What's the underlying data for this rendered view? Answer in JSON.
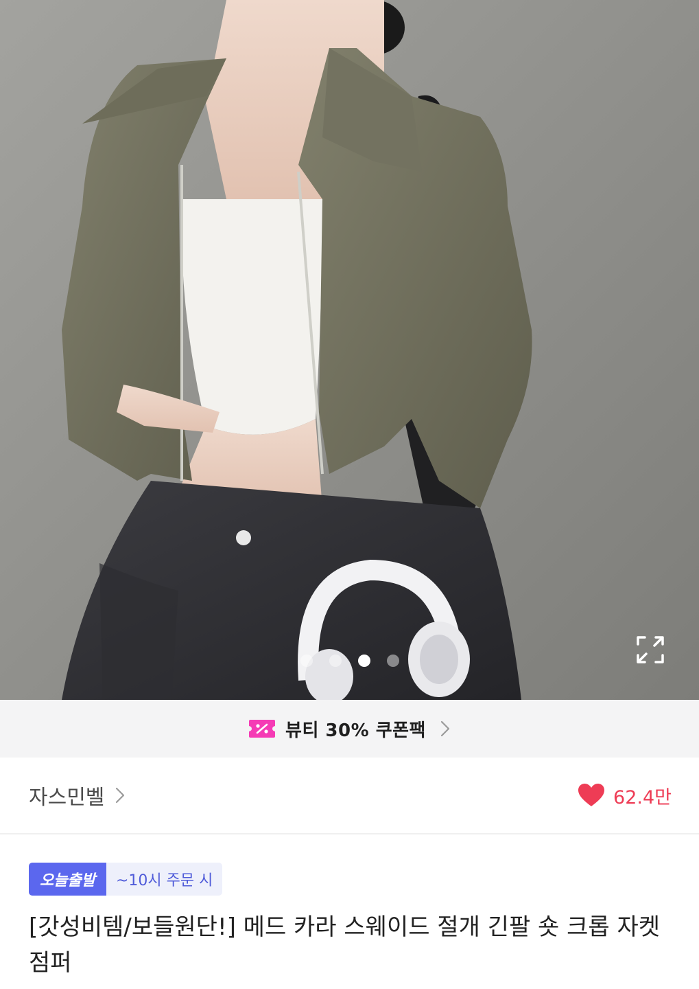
{
  "carousel": {
    "total": 4,
    "active_index": 2,
    "image_icon": "product-photo",
    "expand_icon": "expand-icon"
  },
  "coupon": {
    "label": "뷰티 30% 쿠폰팩",
    "icon": "coupon-percent-icon",
    "icon_color": "#f53bb5",
    "chevron_icon": "chevron-right-icon"
  },
  "store": {
    "name": "자스민벨",
    "chevron_icon": "chevron-right-icon",
    "likes": "62.4만",
    "like_icon": "heart-icon",
    "like_color": "#ee3c55"
  },
  "badges": {
    "today": "오늘출발",
    "time": "~10시 주문 시",
    "today_color": "#5b67ee"
  },
  "product": {
    "title": "[갓성비템/보들원단!] 메드 카라 스웨이드 절개 긴팔 숏 크롭 자켓 점퍼"
  }
}
